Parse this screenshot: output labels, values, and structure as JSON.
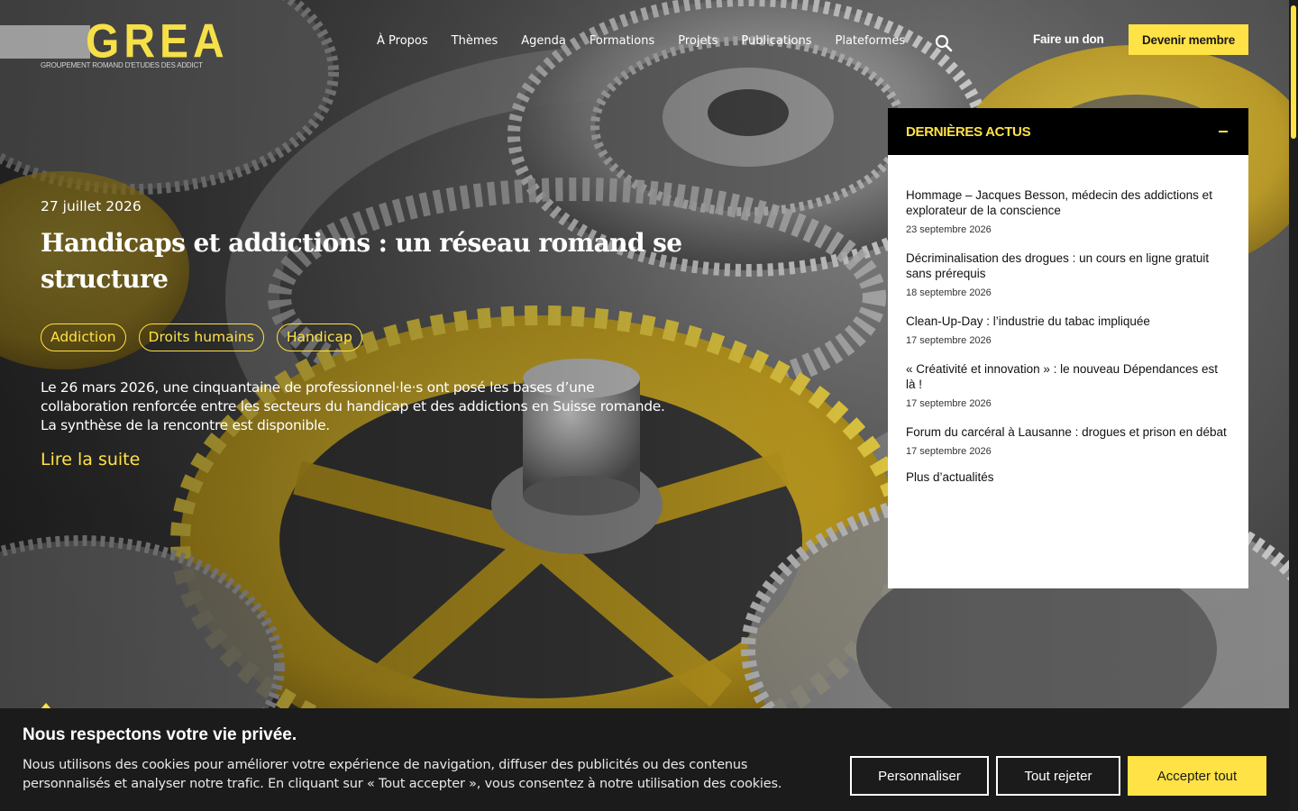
{
  "colors": {
    "accent": "#ffe245",
    "dark": "#000000",
    "banner": "#1b1b1b"
  },
  "header": {
    "logo_text": "GREA",
    "logo_subtitle": "GROUPEMENT ROMAND D'ETUDES DES ADDICTIONS",
    "nav": [
      "À Propos",
      "Thèmes",
      "Agenda",
      "Formations",
      "Projets",
      "Publications",
      "Plateformes"
    ],
    "search_icon": "search-icon",
    "donate_label": "Faire un don",
    "member_label": "Devenir membre"
  },
  "hero": {
    "date": "27 juillet 2026",
    "title": "Handicaps et addictions : un réseau romand se structure",
    "tags": [
      "Addiction",
      "Droits humains",
      "Handicap"
    ],
    "excerpt": "Le 26 mars 2026, une cinquantaine de professionnel·le·s ont posé les bases d’une collaboration renforcée entre les secteurs du handicap et des addictions en Suisse romande. La synthèse de la rencontre est disponible.",
    "read_more": "Lire la suite"
  },
  "news": {
    "title": "DERNIÈRES ACTUS",
    "items": [
      {
        "title": "Hommage – Jacques Besson, médecin des addictions et explorateur de la conscience",
        "date": "23 septembre 2026"
      },
      {
        "title": "Décriminalisation des drogues : un cours en ligne gratuit sans prérequis",
        "date": "18 septembre 2026"
      },
      {
        "title": "Clean-Up-Day : l’industrie du tabac impliquée",
        "date": "17 septembre 2026"
      },
      {
        "title": "« Créativité et innovation » : le nouveau Dépendances est là !",
        "date": "17 septembre 2026"
      },
      {
        "title": "Forum du carcéral à Lausanne : drogues et prison en débat",
        "date": "17 septembre 2026"
      }
    ],
    "more": "Plus d’actualités"
  },
  "cookie": {
    "title": "Nous respectons votre vie privée.",
    "text": "Nous utilisons des cookies pour améliorer votre expérience de navigation, diffuser des publicités ou des contenus personnalisés et analyser notre trafic. En cliquant sur « Tout accepter », vous consentez à notre utilisation des cookies.",
    "customize": "Personnaliser",
    "reject": "Tout rejeter",
    "accept": "Accepter tout"
  }
}
